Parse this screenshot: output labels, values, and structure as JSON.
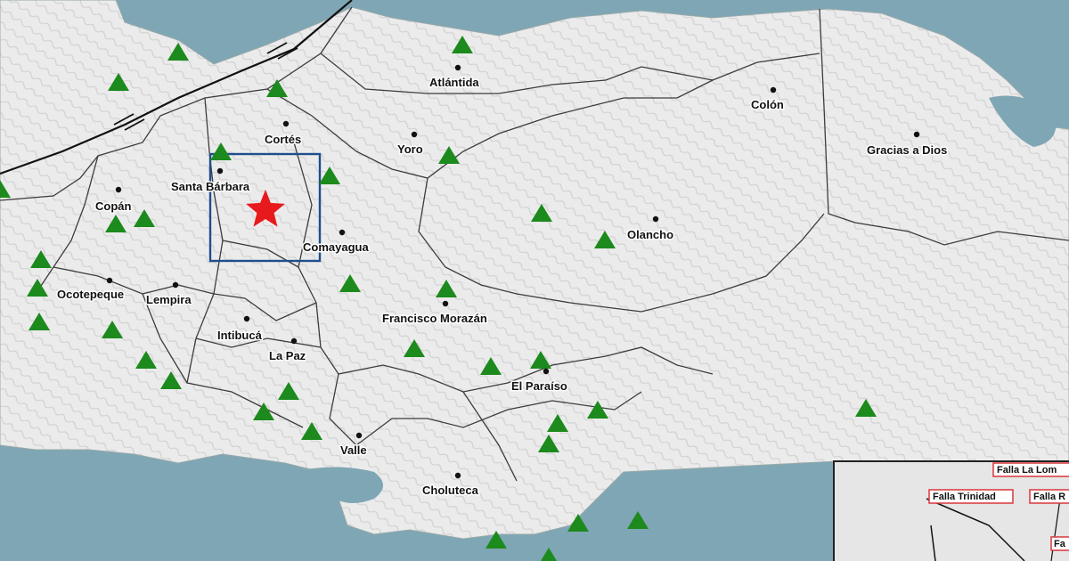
{
  "map": {
    "colors": {
      "water": "#7fa6b4",
      "land": "#ececec",
      "border": "#444444",
      "station": "#1c8a1c",
      "epicenter": "#e8191c",
      "box": "#1f4e8c",
      "fault_box": "#d9363e"
    },
    "departments": [
      {
        "id": "atlantida",
        "label": "Atlántida"
      },
      {
        "id": "colon",
        "label": "Colón"
      },
      {
        "id": "gracias",
        "label": "Gracias a Dios"
      },
      {
        "id": "cortes",
        "label": "Cortés"
      },
      {
        "id": "yoro",
        "label": "Yoro"
      },
      {
        "id": "santa-barbara",
        "label": "Santa Bárbara"
      },
      {
        "id": "copan",
        "label": "Copán"
      },
      {
        "id": "olancho",
        "label": "Olancho"
      },
      {
        "id": "comayagua",
        "label": "Comayagua"
      },
      {
        "id": "ocotepeque",
        "label": "Ocotepeque"
      },
      {
        "id": "lempira",
        "label": "Lempira"
      },
      {
        "id": "francisco-morazan",
        "label": "Francisco Morazán"
      },
      {
        "id": "intibuca",
        "label": "Intibucá"
      },
      {
        "id": "la-paz",
        "label": "La Paz"
      },
      {
        "id": "el-paraiso",
        "label": "El Paraíso"
      },
      {
        "id": "valle",
        "label": "Valle"
      },
      {
        "id": "choluteca",
        "label": "Choluteca"
      }
    ],
    "station_icon": "green-triangle-icon",
    "epicenter_icon": "red-star-icon",
    "inset_faults": [
      "Falla La Lom",
      "Falla Trinidad",
      "Falla R"
    ]
  }
}
